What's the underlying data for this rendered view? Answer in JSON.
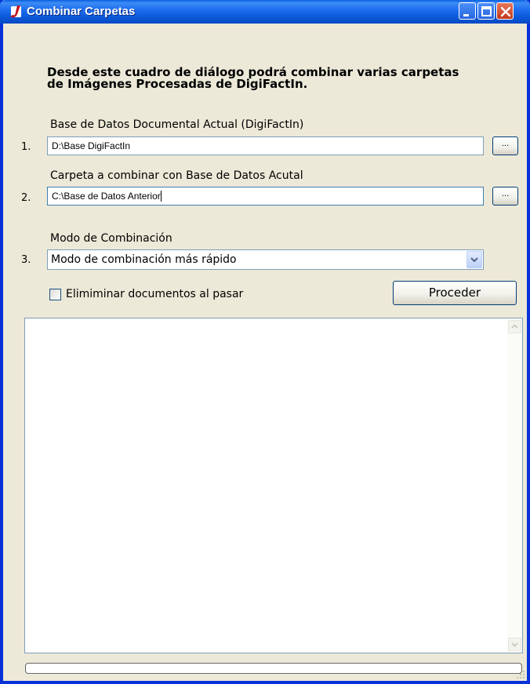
{
  "window": {
    "title": "Combinar Carpetas"
  },
  "heading": {
    "line1": "Desde este cuadro de diálogo podrá combinar varias carpetas",
    "line2": "de Imágenes Procesadas de DigiFactIn."
  },
  "step1": {
    "number": "1.",
    "label": "Base de Datos Documental Actual (DigiFactIn)",
    "value": "D:\\Base DigiFactIn",
    "browse_label": "..."
  },
  "step2": {
    "number": "2.",
    "label": "Carpeta a combinar con Base de Datos Acutal",
    "value": "C:\\Base de Datos Anterior",
    "browse_label": "..."
  },
  "step3": {
    "number": "3.",
    "label": "Modo de Combinación",
    "selected": "Modo de combinación más rápido"
  },
  "delete_option": {
    "label": "Elimiminar documentos al pasar",
    "checked": false
  },
  "proceed_label": "Proceder",
  "progress": 0,
  "colors": {
    "window_bg": "#ece9d8",
    "titlebar": "#0a58d6",
    "border": "#0831d9"
  }
}
